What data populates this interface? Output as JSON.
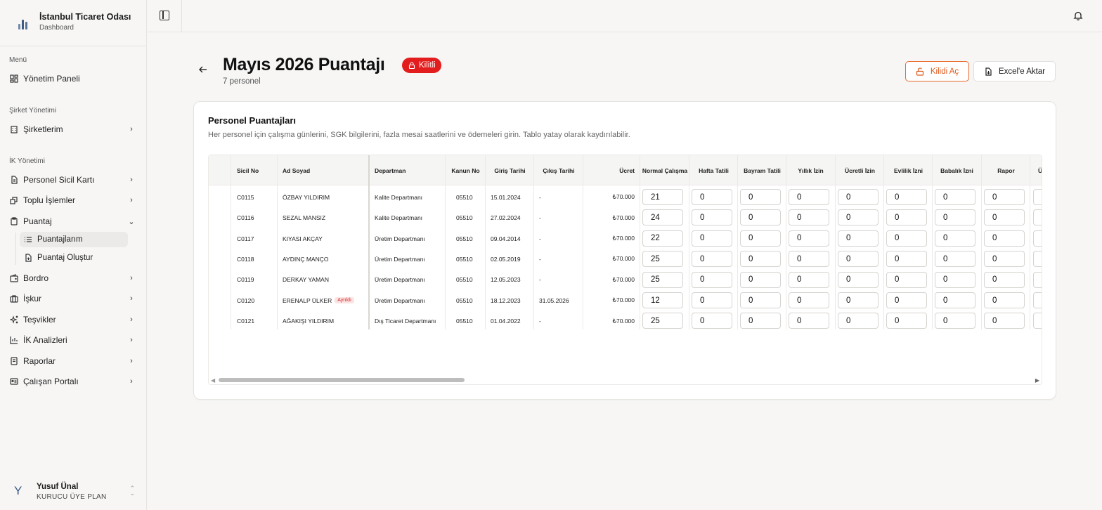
{
  "org": {
    "name": "İstanbul Ticaret Odası",
    "subtitle": "Dashboard"
  },
  "sidebar": {
    "sections": [
      {
        "label": "Menü"
      },
      {
        "label": "Şirket Yönetimi"
      },
      {
        "label": "İK Yönetimi"
      }
    ],
    "items": [
      {
        "label": "Yönetim Paneli",
        "icon": "dashboard-icon"
      },
      {
        "label": "Şirketlerim",
        "icon": "building-icon"
      },
      {
        "label": "Personel Sicil Kartı",
        "icon": "file-icon"
      },
      {
        "label": "Toplu İşlemler",
        "icon": "layers-icon"
      },
      {
        "label": "Puantaj",
        "icon": "clipboard-icon"
      },
      {
        "label": "Bordro",
        "icon": "wallet-icon"
      },
      {
        "label": "İşkur",
        "icon": "briefcase-icon"
      },
      {
        "label": "Teşvikler",
        "icon": "sparkles-icon"
      },
      {
        "label": "İK Analizleri",
        "icon": "bar-chart-icon"
      },
      {
        "label": "Raporlar",
        "icon": "report-icon"
      },
      {
        "label": "Çalışan Portalı",
        "icon": "id-card-icon"
      }
    ],
    "subitems": [
      {
        "label": "Puantajlarım",
        "icon": "list-icon",
        "active": true
      },
      {
        "label": "Puantaj Oluştur",
        "icon": "file-plus-icon",
        "active": false
      }
    ]
  },
  "user": {
    "initial": "Y",
    "name": "Yusuf Ünal",
    "plan": "KURUCU ÜYE PLAN"
  },
  "header": {
    "title": "Mayıs 2026 Puantajı",
    "lock_badge": "Kilitli",
    "count": "7 personel",
    "unlock_label": "Kilidi Aç",
    "export_label": "Excel'e Aktar"
  },
  "card": {
    "title": "Personel Puantajları",
    "description": "Her personel için çalışma günlerini, SGK bilgilerini, fazla mesai saatlerini ve ödemeleri girin. Tablo yatay olarak kaydırılabilir."
  },
  "table": {
    "columns": [
      "Sicil No",
      "Ad Soyad",
      "Departman",
      "Kanun No",
      "Giriş Tarihi",
      "Çıkış Tarihi",
      "Ücret",
      "Normal Çalışma",
      "Hafta Tatili",
      "Bayram Tatili",
      "Yıllık İzin",
      "Ücretli İzin",
      "Evlilik İzni",
      "Babalık İzni",
      "Rapor",
      "Ü"
    ],
    "rows": [
      {
        "sicil": "C0115",
        "name": "ÖZBAY YILDIRIM",
        "badge": "",
        "dept": "Kalite Departmanı",
        "kanun": "05510",
        "giris": "15.01.2024",
        "cikis": "-",
        "ucret": "₺70.000",
        "values": [
          "21",
          "0",
          "0",
          "0",
          "0",
          "0",
          "0",
          "0"
        ]
      },
      {
        "sicil": "C0116",
        "name": "SEZAL MANSIZ",
        "badge": "",
        "dept": "Kalite Departmanı",
        "kanun": "05510",
        "giris": "27.02.2024",
        "cikis": "-",
        "ucret": "₺70.000",
        "values": [
          "24",
          "0",
          "0",
          "0",
          "0",
          "0",
          "0",
          "0"
        ]
      },
      {
        "sicil": "C0117",
        "name": "KIYASI AKÇAY",
        "badge": "",
        "dept": "Üretim Departmanı",
        "kanun": "05510",
        "giris": "09.04.2014",
        "cikis": "-",
        "ucret": "₺70.000",
        "values": [
          "22",
          "0",
          "0",
          "0",
          "0",
          "0",
          "0",
          "0"
        ]
      },
      {
        "sicil": "C0118",
        "name": "AYDINÇ MANÇO",
        "badge": "",
        "dept": "Üretim Departmanı",
        "kanun": "05510",
        "giris": "02.05.2019",
        "cikis": "-",
        "ucret": "₺70.000",
        "values": [
          "25",
          "0",
          "0",
          "0",
          "0",
          "0",
          "0",
          "0"
        ]
      },
      {
        "sicil": "C0119",
        "name": "DERKAY YAMAN",
        "badge": "",
        "dept": "Üretim Departmanı",
        "kanun": "05510",
        "giris": "12.05.2023",
        "cikis": "-",
        "ucret": "₺70.000",
        "values": [
          "25",
          "0",
          "0",
          "0",
          "0",
          "0",
          "0",
          "0"
        ]
      },
      {
        "sicil": "C0120",
        "name": "ERENALP ÜLKER",
        "badge": "Ayrıldı",
        "dept": "Üretim Departmanı",
        "kanun": "05510",
        "giris": "18.12.2023",
        "cikis": "31.05.2026",
        "ucret": "₺70.000",
        "values": [
          "12",
          "0",
          "0",
          "0",
          "0",
          "0",
          "0",
          "0"
        ]
      },
      {
        "sicil": "C0121",
        "name": "AĞAKIŞI YILDIRIM",
        "badge": "",
        "dept": "Dış Ticaret Departmanı",
        "kanun": "05510",
        "giris": "01.04.2022",
        "cikis": "-",
        "ucret": "₺70.000",
        "values": [
          "25",
          "0",
          "0",
          "0",
          "0",
          "0",
          "0",
          "0"
        ]
      }
    ]
  },
  "colors": {
    "accent": "#e31d1d",
    "unlock": "#ea6a2c",
    "brand": "#3b5b85"
  }
}
